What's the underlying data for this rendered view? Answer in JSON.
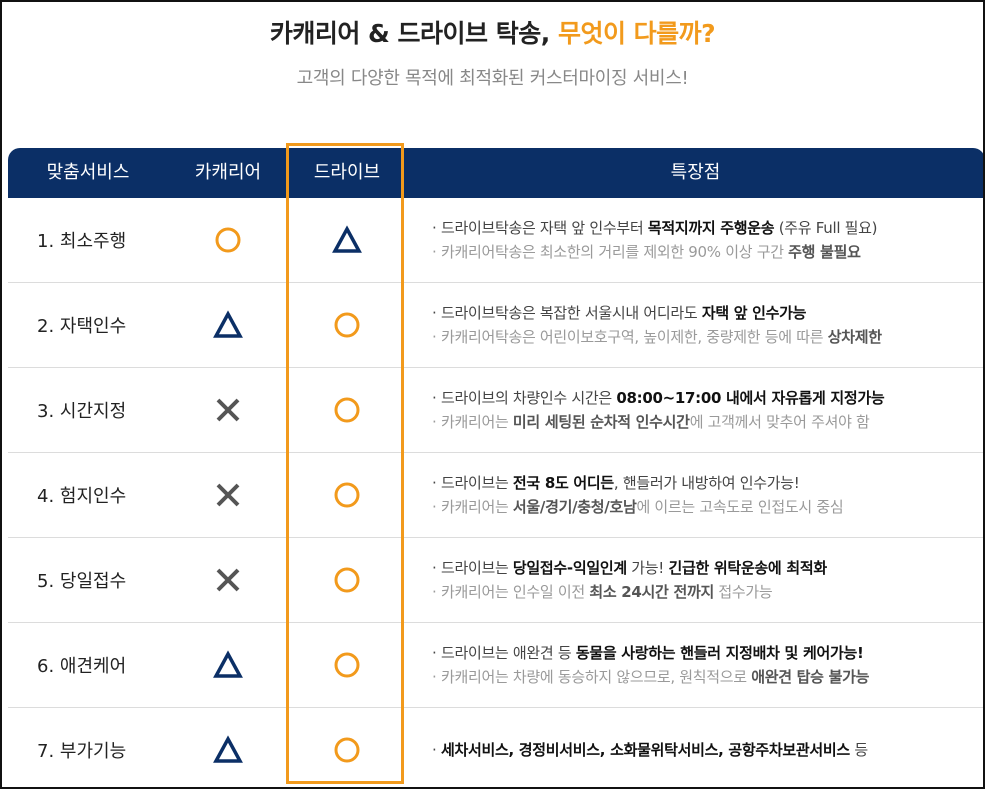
{
  "heading": {
    "main": "카캐리어 & 드라이브 탁송, ",
    "accent": "무엇이 다를까?"
  },
  "subheading": "고객의 다양한 목적에 최적화된 커스터마이징 서비스!",
  "columns": [
    "맞춤서비스",
    "카캐리어",
    "드라이브",
    "특장점"
  ],
  "colors": {
    "header_bg": "#0b2f66",
    "accent": "#f29a1c",
    "triangle": "#0b2f66",
    "cross": "#555555"
  },
  "rows": [
    {
      "name": "1. 최소주행",
      "carrier": "circle",
      "drive": "triangle",
      "lines": [
        {
          "prefix": "· ",
          "segs": [
            [
              "드라이브탁송은 자택 앞 인수부터 ",
              false
            ],
            [
              "목적지까지 주행운송",
              true
            ],
            [
              " (주유 Full 필요)",
              false
            ]
          ]
        },
        {
          "prefix": "· ",
          "segs": [
            [
              "카캐리어탁송은 최소한의 거리를 제외한 90% 이상 구간 ",
              false
            ],
            [
              "주행 불필요",
              true
            ]
          ]
        }
      ]
    },
    {
      "name": "2. 자택인수",
      "carrier": "triangle",
      "drive": "circle",
      "lines": [
        {
          "prefix": "· ",
          "segs": [
            [
              "드라이브탁송은 복잡한 서울시내 어디라도 ",
              false
            ],
            [
              "자택 앞 인수가능",
              true
            ]
          ]
        },
        {
          "prefix": "· ",
          "segs": [
            [
              "카캐리어탁송은 어린이보호구역, 높이제한, 중량제한 등에 따른 ",
              false
            ],
            [
              "상차제한",
              true
            ]
          ]
        }
      ]
    },
    {
      "name": "3. 시간지정",
      "carrier": "cross",
      "drive": "circle",
      "lines": [
        {
          "prefix": "· ",
          "segs": [
            [
              "드라이브의 차량인수 시간은 ",
              false
            ],
            [
              "08:00~17:00 내에서 자유롭게 지정가능",
              true
            ]
          ]
        },
        {
          "prefix": "· ",
          "segs": [
            [
              "카캐리어는 ",
              false
            ],
            [
              "미리 세팅된 순차적 인수시간",
              true
            ],
            [
              "에 고객께서 맞추어 주셔야 함",
              false
            ]
          ]
        }
      ]
    },
    {
      "name": "4. 험지인수",
      "carrier": "cross",
      "drive": "circle",
      "lines": [
        {
          "prefix": "· ",
          "segs": [
            [
              "드라이브는 ",
              false
            ],
            [
              "전국 8도 어디든",
              true
            ],
            [
              ", 핸들러가 내방하여 인수가능!",
              false
            ]
          ]
        },
        {
          "prefix": "· ",
          "segs": [
            [
              "카캐리어는 ",
              false
            ],
            [
              "서울/경기/충청/호남",
              true
            ],
            [
              "에 이르는 고속도로 인접도시 중심",
              false
            ]
          ]
        }
      ]
    },
    {
      "name": "5. 당일접수",
      "carrier": "cross",
      "drive": "circle",
      "lines": [
        {
          "prefix": "· ",
          "segs": [
            [
              "드라이브는 ",
              false
            ],
            [
              "당일접수-익일인계",
              true
            ],
            [
              " 가능! ",
              false
            ],
            [
              "긴급한 위탁운송에 최적화",
              true
            ]
          ]
        },
        {
          "prefix": "· ",
          "segs": [
            [
              "카캐리어는 인수일 이전 ",
              false
            ],
            [
              "최소 24시간 전까지",
              true
            ],
            [
              " 접수가능",
              false
            ]
          ]
        }
      ]
    },
    {
      "name": "6. 애견케어",
      "carrier": "triangle",
      "drive": "circle",
      "lines": [
        {
          "prefix": "· ",
          "segs": [
            [
              "드라이브는 애완견 등 ",
              false
            ],
            [
              "동물을 사랑하는 핸들러 지정배차 및 케어가능!",
              true
            ]
          ]
        },
        {
          "prefix": "· ",
          "segs": [
            [
              "카캐리어는 차량에 동승하지 않으므로, 원칙적으로 ",
              false
            ],
            [
              "애완견 탑승 불가능",
              true
            ]
          ]
        }
      ]
    },
    {
      "name": "7. 부가기능",
      "carrier": "triangle",
      "drive": "circle",
      "lines": [
        {
          "prefix": "· ",
          "segs": [
            [
              "세차서비스, 경정비서비스, 소화물위탁서비스, 공항주차보관서비스",
              true
            ],
            [
              " 등",
              false
            ]
          ]
        }
      ]
    }
  ]
}
